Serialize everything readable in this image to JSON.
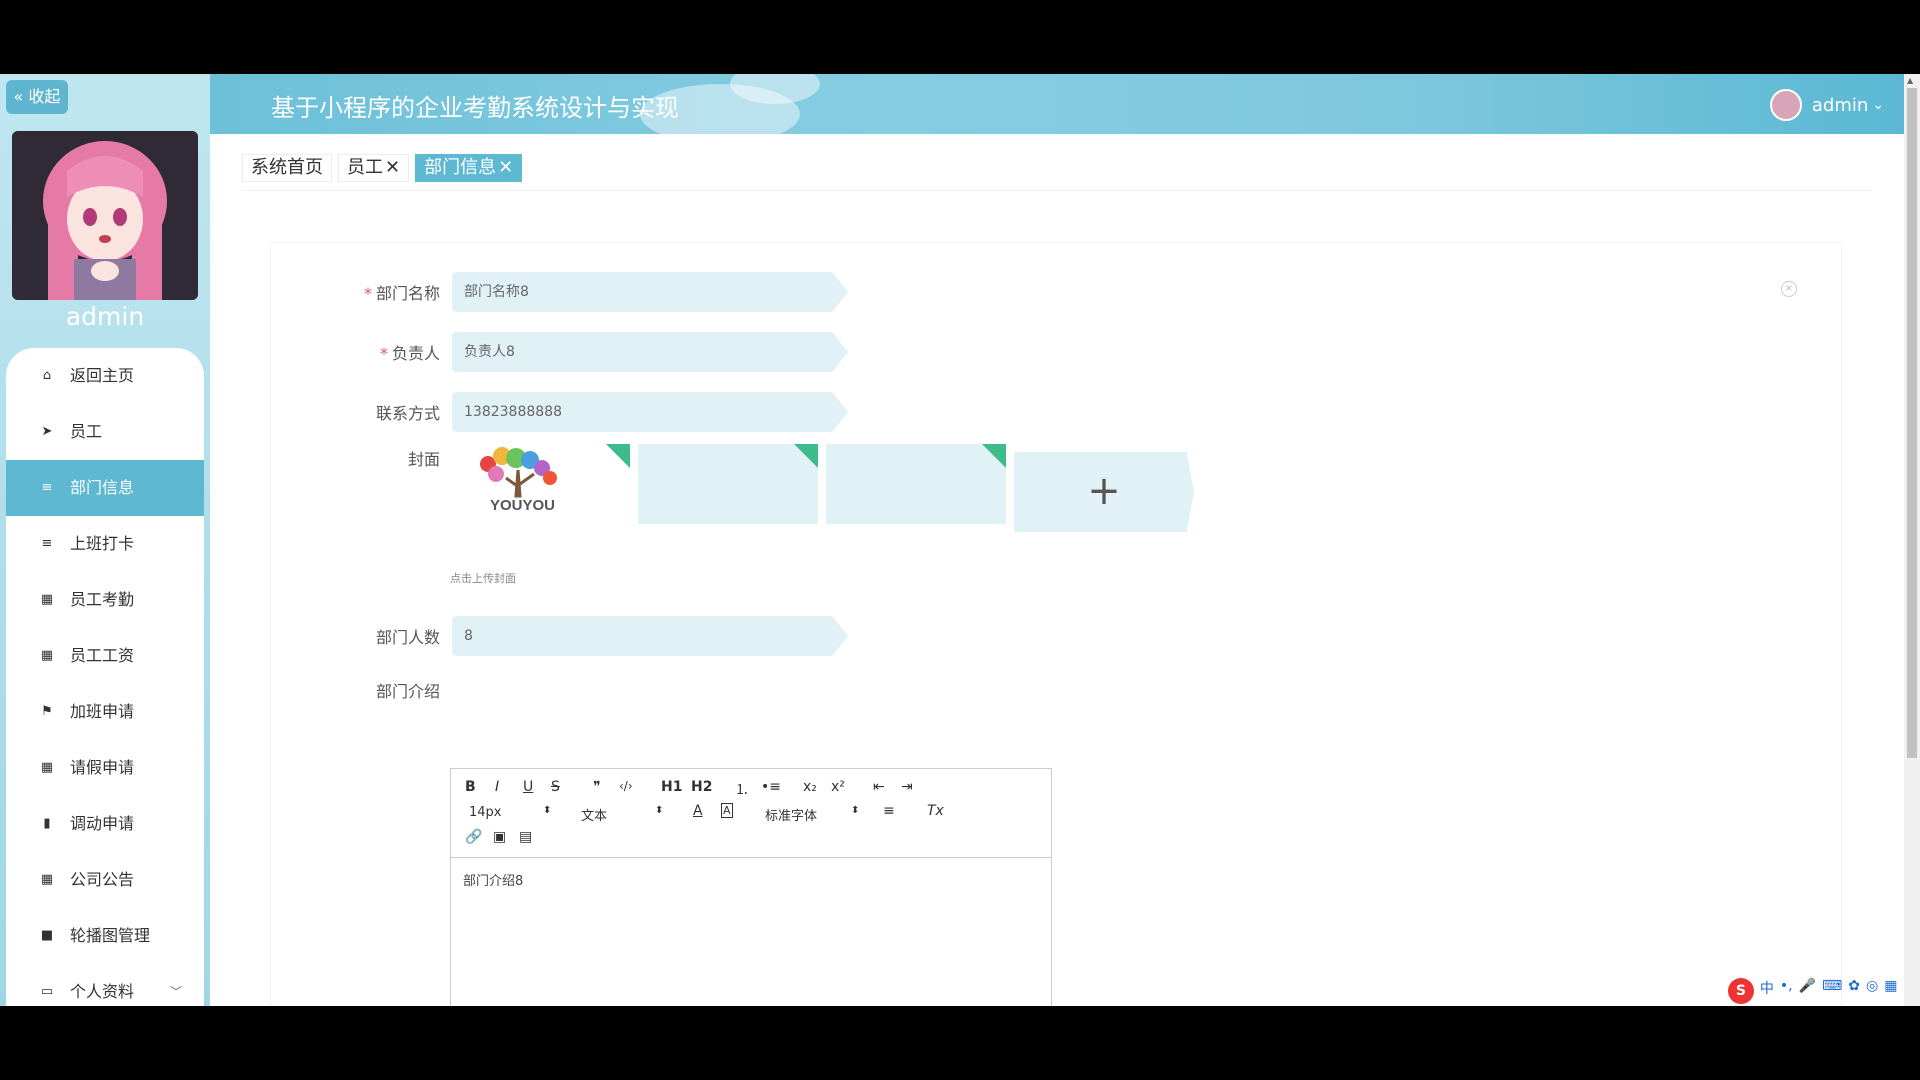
{
  "sidebar": {
    "collapse_label": "« 收起",
    "username": "admin",
    "menu": [
      {
        "label": "返回主页",
        "icon": "home-icon",
        "glyph": "⌂"
      },
      {
        "label": "员工",
        "icon": "send-icon",
        "glyph": "➤"
      },
      {
        "label": "部门信息",
        "icon": "list-icon",
        "glyph": "≡",
        "active": true
      },
      {
        "label": "上班打卡",
        "icon": "list-icon",
        "glyph": "≡"
      },
      {
        "label": "员工考勤",
        "icon": "grid-icon",
        "glyph": "▦"
      },
      {
        "label": "员工工资",
        "icon": "grid-icon",
        "glyph": "▦"
      },
      {
        "label": "加班申请",
        "icon": "flag-icon",
        "glyph": "⚑"
      },
      {
        "label": "请假申请",
        "icon": "grid-icon",
        "glyph": "▦"
      },
      {
        "label": "调动申请",
        "icon": "bar-chart-icon",
        "glyph": "▮"
      },
      {
        "label": "公司公告",
        "icon": "grid-icon",
        "glyph": "▦"
      },
      {
        "label": "轮播图管理",
        "icon": "video-icon",
        "glyph": "■"
      },
      {
        "label": "个人资料",
        "icon": "profile-icon",
        "glyph": "▭",
        "caret": "﹀"
      }
    ]
  },
  "header": {
    "title": "基于小程序的企业考勤系统设计与实现",
    "user": "admin",
    "user_caret": "⌄"
  },
  "tabs": [
    {
      "label": "系统首页",
      "close": ""
    },
    {
      "label": "员工",
      "close": "✕"
    },
    {
      "label": "部门信息",
      "close": "✕",
      "active": true
    }
  ],
  "form": {
    "dept_name": {
      "label": "部门名称",
      "value": "部门名称8",
      "required": "*"
    },
    "manager": {
      "label": "负责人",
      "value": "负责人8",
      "required": "*"
    },
    "contact": {
      "label": "联系方式",
      "value": "13823888888"
    },
    "cover": {
      "label": "封面",
      "hint": "点击上传封面",
      "upload_glyph": "+",
      "logo_text": "YOUYOU"
    },
    "headcount": {
      "label": "部门人数",
      "value": "8"
    },
    "intro": {
      "label": "部门介绍",
      "content": "部门介绍8"
    }
  },
  "editor_toolbar": {
    "bold": "B",
    "italic": "I",
    "underline": "U",
    "strike": "S",
    "quote": "❞",
    "code": "‹/›",
    "h1": "H1",
    "h2": "H2",
    "ol": "⒈",
    "ul": "•≡",
    "sub": "x₂",
    "sup": "x²",
    "outdent": "⇤",
    "indent": "⇥",
    "size": "14px",
    "format": "文本",
    "color": "A",
    "bg": "A",
    "font": "标准字体",
    "align": "≡",
    "clear": "Tx",
    "link": "🔗",
    "image": "▣",
    "video": "▤"
  },
  "ime": {
    "logo": "S",
    "mode": "中"
  }
}
